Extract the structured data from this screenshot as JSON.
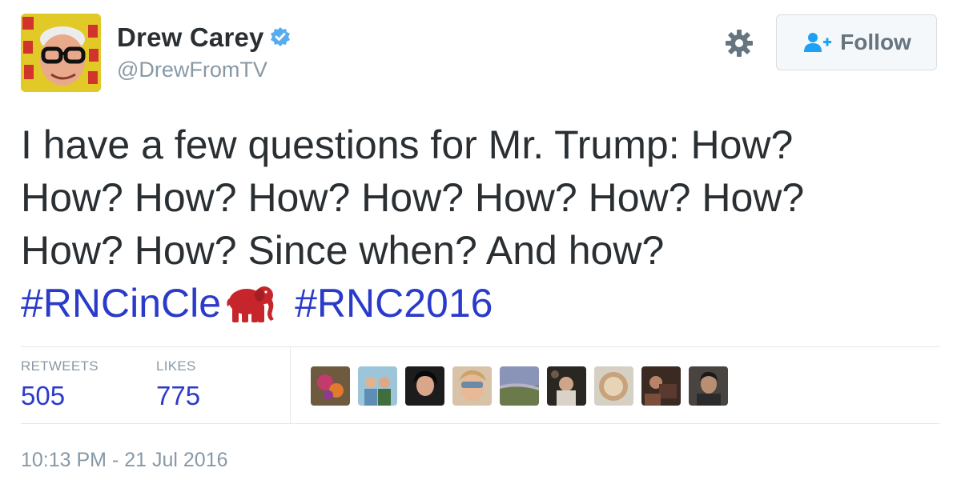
{
  "author": {
    "display_name": "Drew Carey",
    "handle": "@DrewFromTV",
    "verified": true,
    "avatar": "drew-carey-avatar"
  },
  "actions": {
    "settings_icon": "gear-icon",
    "follow_label": "Follow",
    "follow_icon": "add-user-icon"
  },
  "tweet": {
    "lines": [
      "I have a few questions for Mr. Trump: How?",
      "How? How? How? How? How? How? How?",
      "How? How? Since when? And how?"
    ],
    "hashtags": [
      "#RNCinCle",
      "#RNC2016"
    ],
    "emoji": "elephant-icon"
  },
  "stats": {
    "retweets_label": "RETWEETS",
    "retweets_count": "505",
    "likes_label": "LIKES",
    "likes_count": "775"
  },
  "likers_count": 9,
  "timestamp": "10:13 PM - 21 Jul 2016",
  "colors": {
    "text": "#292f33",
    "muted": "#8899a6",
    "link": "#2b3bc9",
    "verified": "#55acee",
    "elephant": "#c6262b",
    "follow_bg": "#f5f8fa",
    "divider": "#e1e8ed"
  }
}
